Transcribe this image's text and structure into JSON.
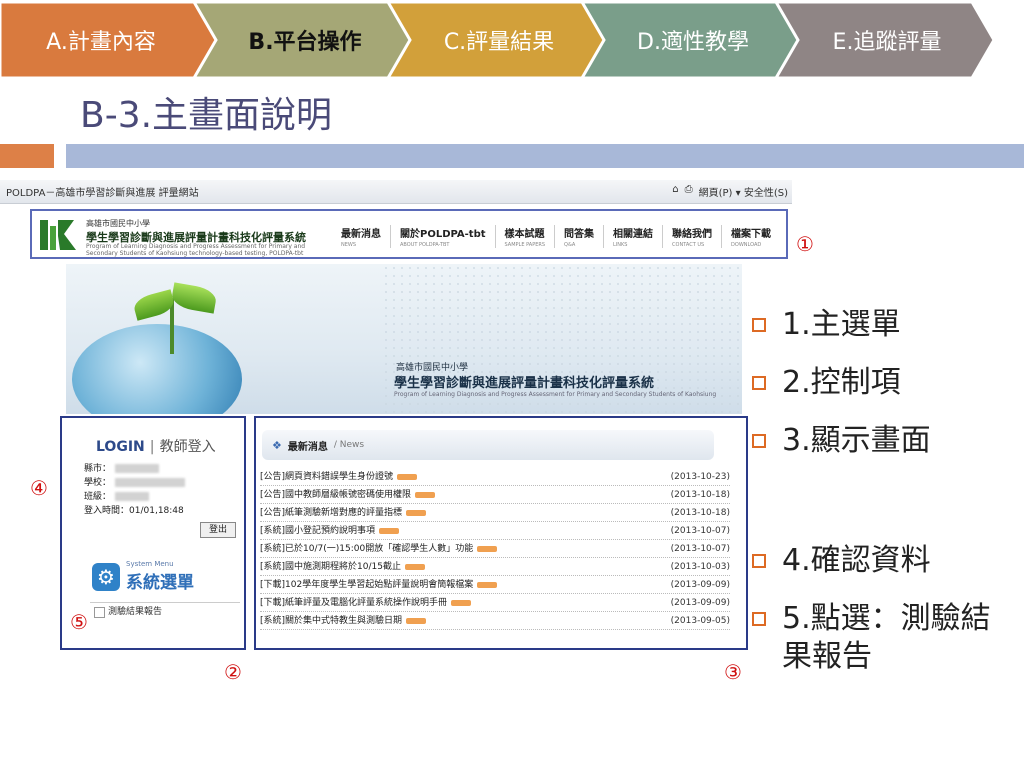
{
  "nav": {
    "items": [
      {
        "label": "A.計畫內容",
        "color": "#d97a3e",
        "active": false
      },
      {
        "label": "B.平台操作",
        "color": "#a5a776",
        "active": true
      },
      {
        "label": "C.評量結果",
        "color": "#d2a03a",
        "active": false
      },
      {
        "label": "D.適性教學",
        "color": "#7a9e8a",
        "active": false
      },
      {
        "label": "E.追蹤評量",
        "color": "#8f8585",
        "active": false
      }
    ]
  },
  "slide": {
    "title": "B-3.主畫面說明",
    "accent_orange": "#dd8047",
    "accent_blue": "#a8b8d8"
  },
  "browser": {
    "title": "POLDPA－高雄市學習診斷與進展 評量網站",
    "tools": "網頁(P) ▾  安全性(S)"
  },
  "site": {
    "org": "高雄市國民中小學",
    "name": "學生學習診斷與進展評量計畫科技化評量系統",
    "en": "Program of Learning Diagnosis and Progress Assessment for Primary and Secondary Students of Kaohsiung technology-based testing, POLDPA-tbt",
    "menu": [
      {
        "zh": "最新消息",
        "en": "NEWS"
      },
      {
        "zh": "關於POLDPA-tbt",
        "en": "ABOUT POLDPA-TBT"
      },
      {
        "zh": "樣本試題",
        "en": "SAMPLE PAPERS"
      },
      {
        "zh": "問答集",
        "en": "Q&A"
      },
      {
        "zh": "相關連結",
        "en": "LINKS"
      },
      {
        "zh": "聯絡我們",
        "en": "CONTACT US"
      },
      {
        "zh": "檔案下載",
        "en": "DOWNLOAD"
      }
    ]
  },
  "banner": {
    "org": "高雄市國民中小學",
    "name": "學生學習診斷與進展評量計畫科技化評量系統",
    "en": "Program of Learning Diagnosis and Progress Assessment for Primary and Secondary Students of Kaohsiung"
  },
  "login": {
    "title_en": "LOGIN",
    "title_zh": "教師登入",
    "city_label": "縣市：",
    "school_label": "學校：",
    "class_label": "班級：",
    "login_time_label": "登入時間：",
    "login_time": "01/01,18:48",
    "logout": "登出",
    "sys_menu_en": "System Menu",
    "sys_menu_zh": "系統選單",
    "report_link": "測驗結果報告"
  },
  "news": {
    "title_zh": "最新消息",
    "title_en": "/ News",
    "items": [
      {
        "text": "[公告]網頁資料錯誤學生身份證號",
        "date": "(2013-10-23)"
      },
      {
        "text": "[公告]國中教師層級帳號密碼使用權限",
        "date": "(2013-10-18)"
      },
      {
        "text": "[公告]紙筆測驗新增對應的評量指標",
        "date": "(2013-10-18)"
      },
      {
        "text": "[系統]國小登記預約說明事項",
        "date": "(2013-10-07)"
      },
      {
        "text": "[系統]已於10/7(一)15:00開放「確認學生人數」功能",
        "date": "(2013-10-07)"
      },
      {
        "text": "[系統]國中施測期程將於10/15截止",
        "date": "(2013-10-03)"
      },
      {
        "text": "[下載]102學年度學生學習起始點評量說明會簡報檔案",
        "date": "(2013-09-09)"
      },
      {
        "text": "[下載]紙筆評量及電腦化評量系統操作說明手冊",
        "date": "(2013-09-09)"
      },
      {
        "text": "[系統]關於集中式特教生與測驗日期",
        "date": "(2013-09-05)"
      }
    ]
  },
  "callouts": {
    "c1": "①",
    "c2": "②",
    "c3": "③",
    "c4": "④",
    "c5": "⑤",
    "color": "#d01010"
  },
  "bullets": [
    "1.主選單",
    "2.控制項",
    "3.顯示畫面",
    "4.確認資料",
    "5.點選：測驗結果報告"
  ]
}
